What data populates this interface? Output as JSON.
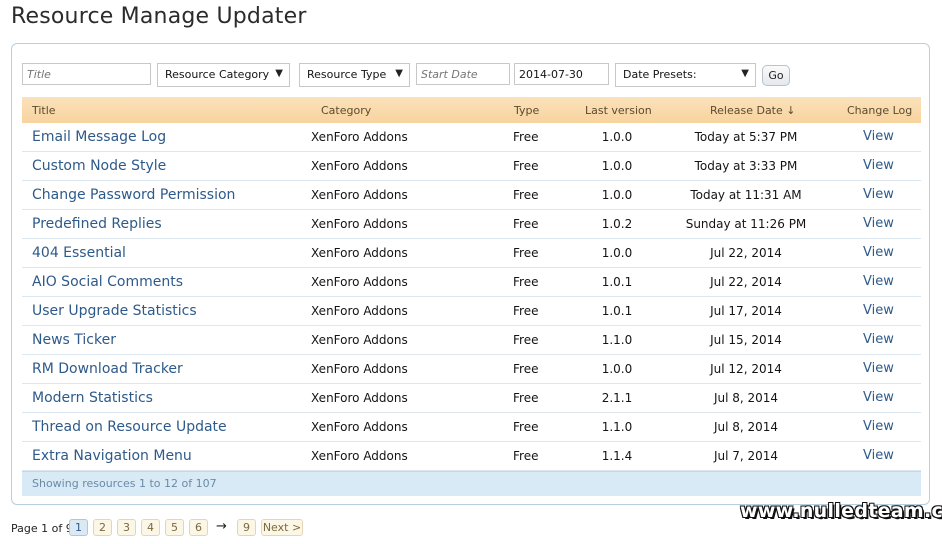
{
  "page": {
    "title": "Resource Manage Updater"
  },
  "filters": {
    "title_placeholder": "Title",
    "category_label": "Resource Category",
    "type_label": "Resource Type",
    "start_date_placeholder": "Start Date",
    "end_date_value": "2014-07-30",
    "presets_label": "Date Presets:",
    "go_label": "Go"
  },
  "table": {
    "headers": {
      "title": "Title",
      "category": "Category",
      "type": "Type",
      "last_version": "Last version",
      "release_date": "Release Date ↓",
      "change_log": "Change Log"
    },
    "rows": [
      {
        "title": "Email Message Log",
        "category": "XenForo Addons",
        "type": "Free",
        "version": "1.0.0",
        "release": "Today at 5:37 PM",
        "log": "View"
      },
      {
        "title": "Custom Node Style",
        "category": "XenForo Addons",
        "type": "Free",
        "version": "1.0.0",
        "release": "Today at 3:33 PM",
        "log": "View"
      },
      {
        "title": "Change Password Permission",
        "category": "XenForo Addons",
        "type": "Free",
        "version": "1.0.0",
        "release": "Today at 11:31 AM",
        "log": "View"
      },
      {
        "title": "Predefined Replies",
        "category": "XenForo Addons",
        "type": "Free",
        "version": "1.0.2",
        "release": "Sunday at 11:26 PM",
        "log": "View"
      },
      {
        "title": "404 Essential",
        "category": "XenForo Addons",
        "type": "Free",
        "version": "1.0.0",
        "release": "Jul 22, 2014",
        "log": "View"
      },
      {
        "title": "AIO Social Comments",
        "category": "XenForo Addons",
        "type": "Free",
        "version": "1.0.1",
        "release": "Jul 22, 2014",
        "log": "View"
      },
      {
        "title": "User Upgrade Statistics",
        "category": "XenForo Addons",
        "type": "Free",
        "version": "1.0.1",
        "release": "Jul 17, 2014",
        "log": "View"
      },
      {
        "title": "News Ticker",
        "category": "XenForo Addons",
        "type": "Free",
        "version": "1.1.0",
        "release": "Jul 15, 2014",
        "log": "View"
      },
      {
        "title": "RM Download Tracker",
        "category": "XenForo Addons",
        "type": "Free",
        "version": "1.0.0",
        "release": "Jul 12, 2014",
        "log": "View"
      },
      {
        "title": "Modern Statistics",
        "category": "XenForo Addons",
        "type": "Free",
        "version": "2.1.1",
        "release": "Jul 8, 2014",
        "log": "View"
      },
      {
        "title": "Thread on Resource Update",
        "category": "XenForo Addons",
        "type": "Free",
        "version": "1.1.0",
        "release": "Jul 8, 2014",
        "log": "View"
      },
      {
        "title": "Extra Navigation Menu",
        "category": "XenForo Addons",
        "type": "Free",
        "version": "1.1.4",
        "release": "Jul 7, 2014",
        "log": "View"
      }
    ],
    "footer": "Showing resources 1 to 12 of 107"
  },
  "pagination": {
    "label": "Page 1 of 9",
    "pages": [
      "1",
      "2",
      "3",
      "4",
      "5",
      "6"
    ],
    "current": "1",
    "arrow": "→",
    "last": "9",
    "next_label": "Next >"
  },
  "watermark": "www.nulledteam.com",
  "colors": {
    "header_bg": "#f7d39e",
    "link": "#2e5a8a",
    "footer_bg": "#d9eaf7",
    "panel_border": "#b8cfe0"
  }
}
